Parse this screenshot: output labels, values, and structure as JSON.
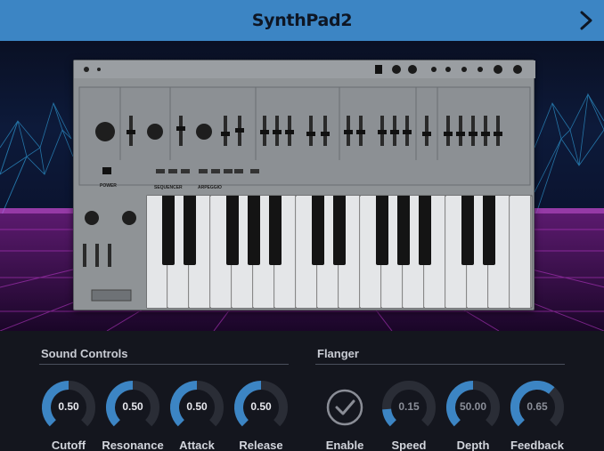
{
  "header": {
    "title": "SynthPad2",
    "next_icon": "chevron-right-icon"
  },
  "colors": {
    "header_bg": "#3c85c4",
    "knob_active": "#3c85c4",
    "knob_track": "#2a2d36",
    "panel_bg": "#14161e"
  },
  "sound_controls": {
    "label": "Sound Controls",
    "knobs": [
      {
        "label": "Cutoff",
        "value": "0.50",
        "level": 0.5
      },
      {
        "label": "Resonance",
        "value": "0.50",
        "level": 0.5
      },
      {
        "label": "Attack",
        "value": "0.50",
        "level": 0.5
      },
      {
        "label": "Release",
        "value": "0.50",
        "level": 0.5
      }
    ]
  },
  "flanger": {
    "label": "Flanger",
    "enable": {
      "label": "Enable",
      "icon": "checkmark-icon"
    },
    "knobs": [
      {
        "label": "Speed",
        "value": "0.15",
        "level": 0.15
      },
      {
        "label": "Depth",
        "value": "50.00",
        "level": 0.5
      },
      {
        "label": "Feedback",
        "value": "0.65",
        "level": 0.65
      }
    ]
  },
  "synth": {
    "power_label": "POWER",
    "sequencer_label": "SEQUENCER",
    "arpeggio_label": "ARPEGGIO"
  }
}
